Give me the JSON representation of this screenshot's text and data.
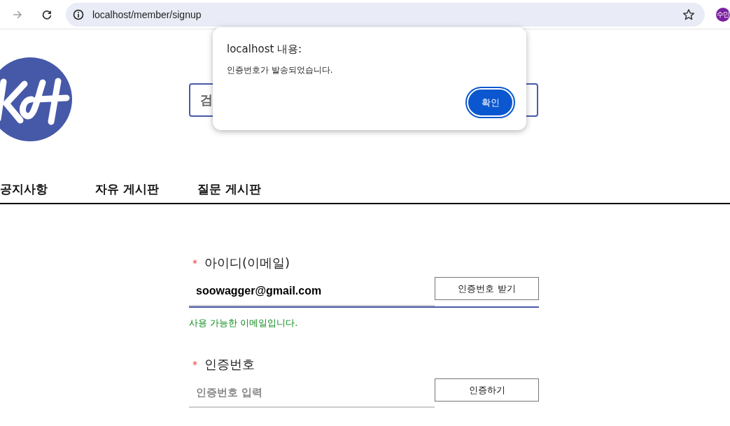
{
  "browser": {
    "url": "localhost/member/signup",
    "profile": "수민"
  },
  "search": {
    "placeholder": "검"
  },
  "nav": [
    {
      "label": "공지사항"
    },
    {
      "label": "자유 게시판"
    },
    {
      "label": "질문 게시판"
    }
  ],
  "form": [
    {
      "required_mark": "*",
      "label": "아이디(이메일)",
      "value": "soowagger@gmail.com",
      "button": "인증번호 받기",
      "focused": true,
      "message": "사용 가능한 이메일입니다."
    },
    {
      "required_mark": "*",
      "label": "인증번호",
      "placeholder": "인증번호 입력",
      "button": "인증하기",
      "focused": false
    }
  ],
  "dialog": {
    "title": "localhost 내용:",
    "message": "인증번호가 발송되었습니다.",
    "button": "확인"
  }
}
